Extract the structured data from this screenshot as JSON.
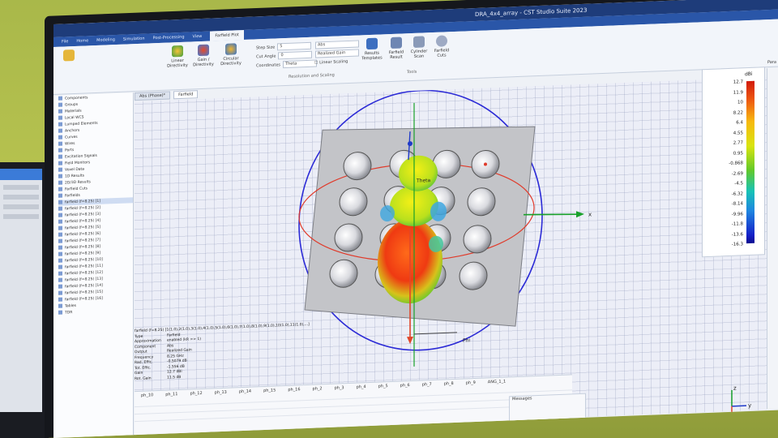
{
  "window": {
    "title": "DRA_4x4_array - CST Studio Suite 2023"
  },
  "ribbon_tabs": [
    "File",
    "Home",
    "Modeling",
    "Simulation",
    "Post-Processing",
    "View",
    "Farfield Plot"
  ],
  "active_ribbon_tab": "Farfield Plot",
  "ribbon": {
    "buttons": [
      {
        "label": "Linear Directivity",
        "icon": "globe-icon"
      },
      {
        "label": "Gain / Directivity",
        "icon": "globe-icon"
      },
      {
        "label": "Circular Directivity",
        "icon": "globe-icon"
      },
      {
        "label": "Results Templates",
        "icon": "template-icon"
      },
      {
        "label": "Farfield Result",
        "icon": "chart-icon"
      },
      {
        "label": "Cylinder Scan",
        "icon": "cylinder-icon"
      },
      {
        "label": "Farfield Cuts",
        "icon": "bowl-icon"
      }
    ],
    "fields": [
      {
        "label": "Step Size",
        "value": "5"
      },
      {
        "label": "Cut Angle",
        "value": "0"
      },
      {
        "label": "Coordinates",
        "value": "Theta"
      },
      {
        "label": "Abs",
        "value": "Abs"
      },
      {
        "label": "Realized Gain",
        "value": "Realized Gain"
      }
    ],
    "checkbox_label": "Linear Scaling",
    "group_label": "Resolution and Scaling",
    "tools_label": "Tools"
  },
  "doc_tabs": [
    "Abs (Phase)*",
    "Farfield"
  ],
  "nav_tree": [
    "Components",
    "Groups",
    "Materials",
    "Local WCS",
    "Lumped Elements",
    "Anchors",
    "Curves",
    "Wires",
    "Ports",
    "Excitation Signals",
    "Field Monitors",
    "Voxel Data",
    "1D Results",
    "2D/3D Results",
    "Farfield Cuts",
    "Farfields",
    "farfield (f=8.25) [1]",
    "farfield (f=8.25) [2]",
    "farfield (f=8.25) [3]",
    "farfield (f=8.25) [4]",
    "farfield (f=8.25) [5]",
    "farfield (f=8.25) [6]",
    "farfield (f=8.25) [7]",
    "farfield (f=8.25) [8]",
    "farfield (f=8.25) [9]",
    "farfield (f=8.25) [10]",
    "farfield (f=8.25) [11]",
    "farfield (f=8.25) [12]",
    "farfield (f=8.25) [13]",
    "farfield (f=8.25) [14]",
    "farfield (f=8.25) [15]",
    "farfield (f=8.25) [16]",
    "Tables",
    "TDR"
  ],
  "nav_selected_index": 16,
  "colorbar": {
    "unit": "dBi",
    "ticks": [
      "12.7",
      "11.9",
      "10",
      "8.22",
      "6.4",
      "4.55",
      "2.77",
      "0.95",
      "-0.868",
      "-2.69",
      "-4.5",
      "-6.32",
      "-8.14",
      "-9.96",
      "-11.8",
      "-13.6",
      "-16.3"
    ]
  },
  "axes": {
    "x": "x",
    "y": "y",
    "z": "z",
    "theta": "Theta",
    "phi": "Phi"
  },
  "info_panel": {
    "header": "farfield (f=8.25) [1(1.0),2(1.0),3(1.0),4(1.0),5(1.0),6(1.0),7(1.0),8(1.0),9(1.0),10(1.0),11(1.0),...]",
    "rows": [
      [
        "Type",
        "Farfield"
      ],
      [
        "Approximation",
        "enabled (kR >> 1)"
      ],
      [
        "Component",
        "Abs"
      ],
      [
        "Output",
        "Realized Gain"
      ],
      [
        "Frequency",
        "8.25 GHz"
      ],
      [
        "Rad. Effic.",
        "-0.5079 dB"
      ],
      [
        "Tot. Effic.",
        "-1.556 dB"
      ],
      [
        "Gain",
        "12.7 dBi"
      ],
      [
        "Rot. Gain",
        "11.5 dB"
      ]
    ]
  },
  "bottom_panel": {
    "columns": [
      "ph_10",
      "ph_11",
      "ph_12",
      "ph_13",
      "ph_14",
      "ph_15",
      "ph_16",
      "ph_2",
      "ph_3",
      "ph_4",
      "ph_5",
      "ph_6",
      "ph_7",
      "ph_8",
      "ph_9",
      "ANG_1_1"
    ],
    "messages_label": "Messages"
  },
  "right_strip_label": "Para"
}
